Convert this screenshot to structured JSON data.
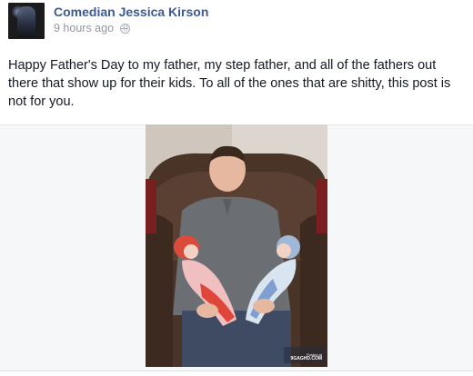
{
  "post": {
    "author": "Comedian Jessica Kirson",
    "timestamp": "9 hours ago",
    "privacy_icon": "globe-icon",
    "text": "Happy Father's Day to my father, my step father, and all of the fathers out there that show up for their kids. To all of the ones that are shitty, this post is not for you."
  },
  "photo": {
    "watermark_small": "Posted at",
    "watermark_brand": "9GAGHD.COM"
  }
}
